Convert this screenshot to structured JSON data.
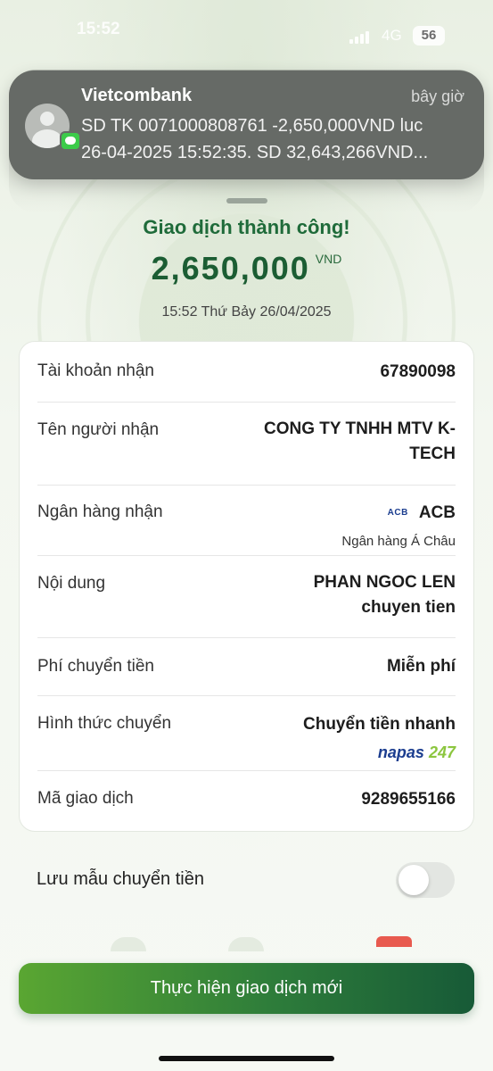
{
  "status_bar": {
    "time": "15:52",
    "network": "4G",
    "battery": "56"
  },
  "notification": {
    "app": "Vietcombank",
    "time": "bây giờ",
    "line1": "SD TK 0071000808761 -2,650,000VND luc",
    "line2": "26-04-2025 15:52:35. SD 32,643,266VND..."
  },
  "result": {
    "title": "Giao dịch thành công!",
    "amount": "2,650,000",
    "currency": "VND",
    "datetime": "15:52 Thứ Bảy 26/04/2025"
  },
  "details": {
    "account_label": "Tài khoản nhận",
    "account_value": "67890098",
    "recipient_label": "Tên người nhận",
    "recipient_line1": "CONG TY TNHH MTV K-",
    "recipient_line2": "TECH",
    "bank_label": "Ngân hàng nhận",
    "bank_logo": "ACB",
    "bank_value": "ACB",
    "bank_fullname": "Ngân hàng Á Châu",
    "content_label": "Nội dung",
    "content_line1": "PHAN NGOC LEN",
    "content_line2": "chuyen tien",
    "fee_label": "Phí chuyển tiền",
    "fee_value": "Miễn phí",
    "method_label": "Hình thức chuyển",
    "method_value": "Chuyển tiền nhanh",
    "method_logo_text": "napas",
    "method_logo_num": "247",
    "txn_label": "Mã giao dịch",
    "txn_value": "9289655166"
  },
  "save_template": {
    "label": "Lưu mẫu chuyển tiền",
    "enabled": false
  },
  "actions": {
    "new_transaction": "Thực hiện giao dịch mới"
  },
  "colors": {
    "primary_green": "#1b5d33",
    "button_start": "#5aa632",
    "button_end": "#175a37"
  }
}
